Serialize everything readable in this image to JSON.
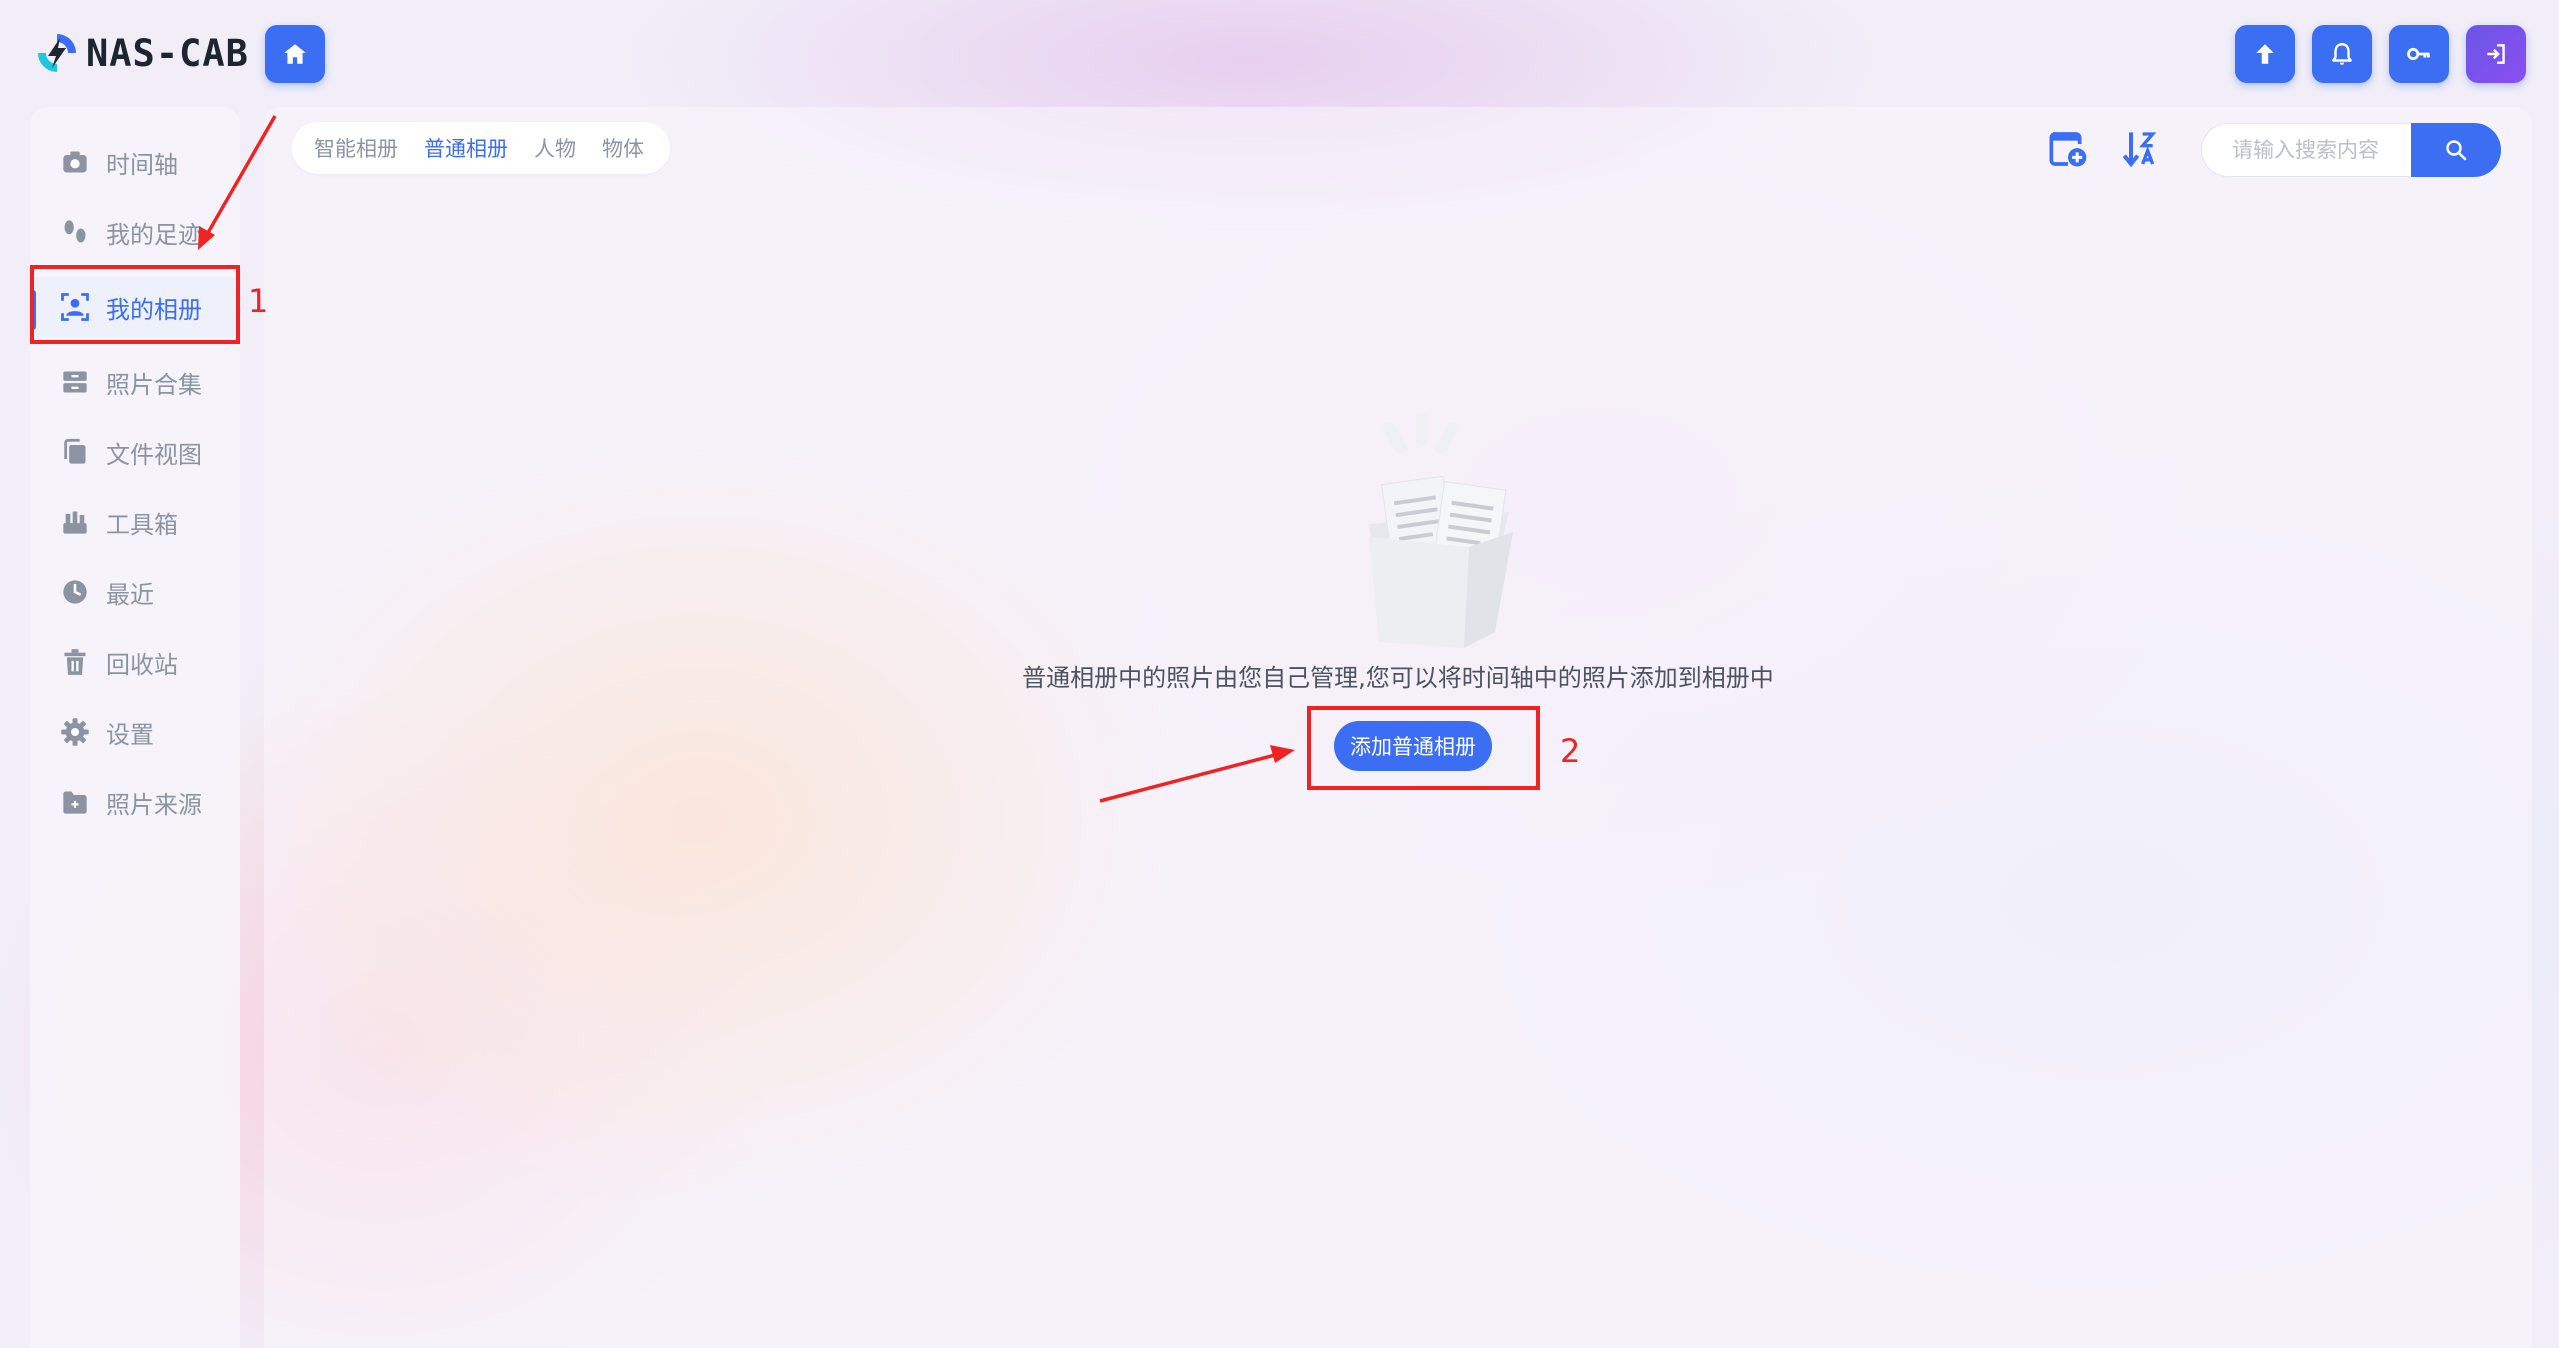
{
  "app": {
    "logo_text": "NAS-CAB"
  },
  "colors": {
    "accent": "#3b6ef2",
    "accent_purple": "#7a52ec",
    "annotation": "#ee2424",
    "muted_text": "#8c94a3"
  },
  "header": {
    "icons": [
      "home-icon",
      "upload-icon",
      "bell-icon",
      "key-icon",
      "logout-icon"
    ]
  },
  "sidebar": {
    "items": [
      {
        "label": "时间轴",
        "icon": "camera-icon"
      },
      {
        "label": "我的足迹",
        "icon": "footprint-icon"
      },
      {
        "label": "我的相册",
        "icon": "portrait-icon"
      },
      {
        "label": "照片合集",
        "icon": "archive-icon"
      },
      {
        "label": "文件视图",
        "icon": "copy-icon"
      },
      {
        "label": "工具箱",
        "icon": "toolbox-icon"
      },
      {
        "label": "最近",
        "icon": "clock-icon"
      },
      {
        "label": "回收站",
        "icon": "trash-icon"
      },
      {
        "label": "设置",
        "icon": "gear-icon"
      },
      {
        "label": "照片来源",
        "icon": "folder-plus-icon"
      }
    ],
    "active_index": 2
  },
  "main": {
    "tabs": [
      {
        "label": "智能相册"
      },
      {
        "label": "普通相册"
      },
      {
        "label": "人物"
      },
      {
        "label": "物体"
      }
    ],
    "active_tab": 1,
    "toolbar_icons": [
      "add-album-icon",
      "sort-z-a-icon"
    ],
    "search": {
      "placeholder": "请输入搜索内容",
      "icon": "search-icon"
    },
    "empty_state": {
      "message": "普通相册中的照片由您自己管理,您可以将时间轴中的照片添加到相册中",
      "button_label": "添加普通相册"
    }
  },
  "annotations": {
    "label_1": "1",
    "label_2": "2"
  }
}
